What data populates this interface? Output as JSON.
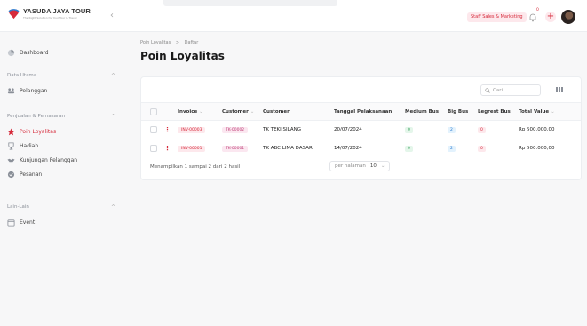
{
  "brand": {
    "title": "YASUDA JAYA TOUR",
    "tagline": "The Right Solution for Your Tour & Travel"
  },
  "header": {
    "role": "Staff Sales & Marketing",
    "notif_count": "0",
    "plus_label": "+"
  },
  "sidebar": {
    "dashboard": "Dashboard",
    "groups": [
      {
        "label": "Data Utama",
        "items": [
          "Pelanggan"
        ]
      },
      {
        "label": "Penjualan & Pemasaran",
        "items": [
          "Poin Loyalitas",
          "Hadiah",
          "Kunjungan Pelanggan",
          "Pesanan"
        ]
      },
      {
        "label": "Lain-Lain",
        "items": [
          "Event"
        ]
      }
    ],
    "active": "Poin Loyalitas"
  },
  "breadcrumb": {
    "parent": "Poin Loyalitas",
    "separator": ">",
    "current": "Daftar"
  },
  "page_title": "Poin Loyalitas",
  "search": {
    "placeholder": "Cari"
  },
  "table": {
    "columns": [
      "Invoice",
      "Customer",
      "Customer",
      "Tanggal Pelaksanaan",
      "Medium Bus",
      "Big Bus",
      "Legrest Bus",
      "Total Value"
    ],
    "rows": [
      {
        "invoice": "INV-00003",
        "customer_code": "TK-00002",
        "customer": "TK TEKI SILANG",
        "date": "20/07/2024",
        "medium": "0",
        "big": "2",
        "legrest": "0",
        "total": "Rp 500.000,00"
      },
      {
        "invoice": "INV-00001",
        "customer_code": "TK-00001",
        "customer": "TK ABC LIMA DASAR",
        "date": "14/07/2024",
        "medium": "0",
        "big": "2",
        "legrest": "0",
        "total": "Rp 500.000,00"
      }
    ]
  },
  "footer": {
    "info": "Menampilkan 1 sampai 2 dari 2 hasil",
    "per_page_label": "per halaman",
    "per_page_value": "10"
  },
  "colors": {
    "accent": "#d62b3b",
    "accent_soft": "#fde8ec"
  }
}
